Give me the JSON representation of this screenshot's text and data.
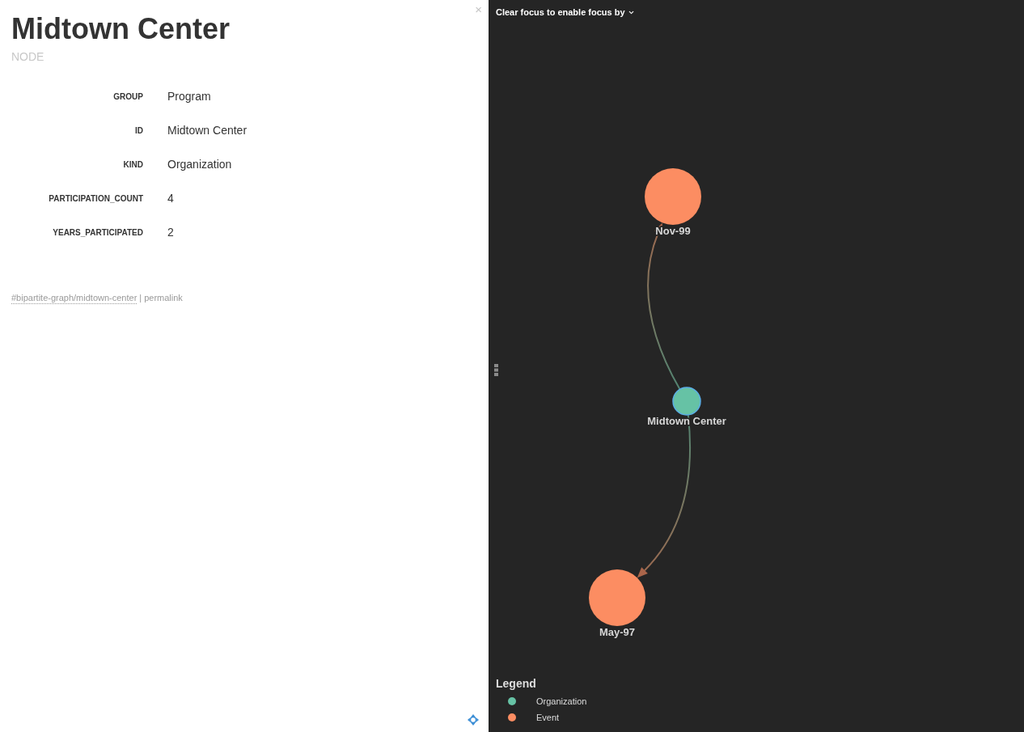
{
  "details": {
    "close": "×",
    "title": "Midtown Center",
    "subtitle": "NODE",
    "properties": [
      {
        "label": "GROUP",
        "value": "Program"
      },
      {
        "label": "ID",
        "value": "Midtown Center"
      },
      {
        "label": "KIND",
        "value": "Organization"
      },
      {
        "label": "PARTICIPATION_COUNT",
        "value": "4"
      },
      {
        "label": "YEARS_PARTICIPATED",
        "value": "2"
      }
    ],
    "anchor_link": "#bipartite-graph/midtown-center",
    "separator": "|",
    "permalink": "permalink"
  },
  "graph": {
    "focus_menu": "Clear focus to enable focus by",
    "nodes": [
      {
        "label": "Nov-99",
        "kind": "event",
        "color": "#fc8d62",
        "selected": false
      },
      {
        "label": "Midtown Center",
        "kind": "organization",
        "color": "#66c2a5",
        "selected": true
      },
      {
        "label": "May-97",
        "kind": "event",
        "color": "#fc8d62",
        "selected": false
      }
    ],
    "legend": {
      "title": "Legend",
      "items": [
        {
          "label": "Organization",
          "color": "#66c2a5"
        },
        {
          "label": "Event",
          "color": "#fc8d62"
        }
      ]
    }
  }
}
